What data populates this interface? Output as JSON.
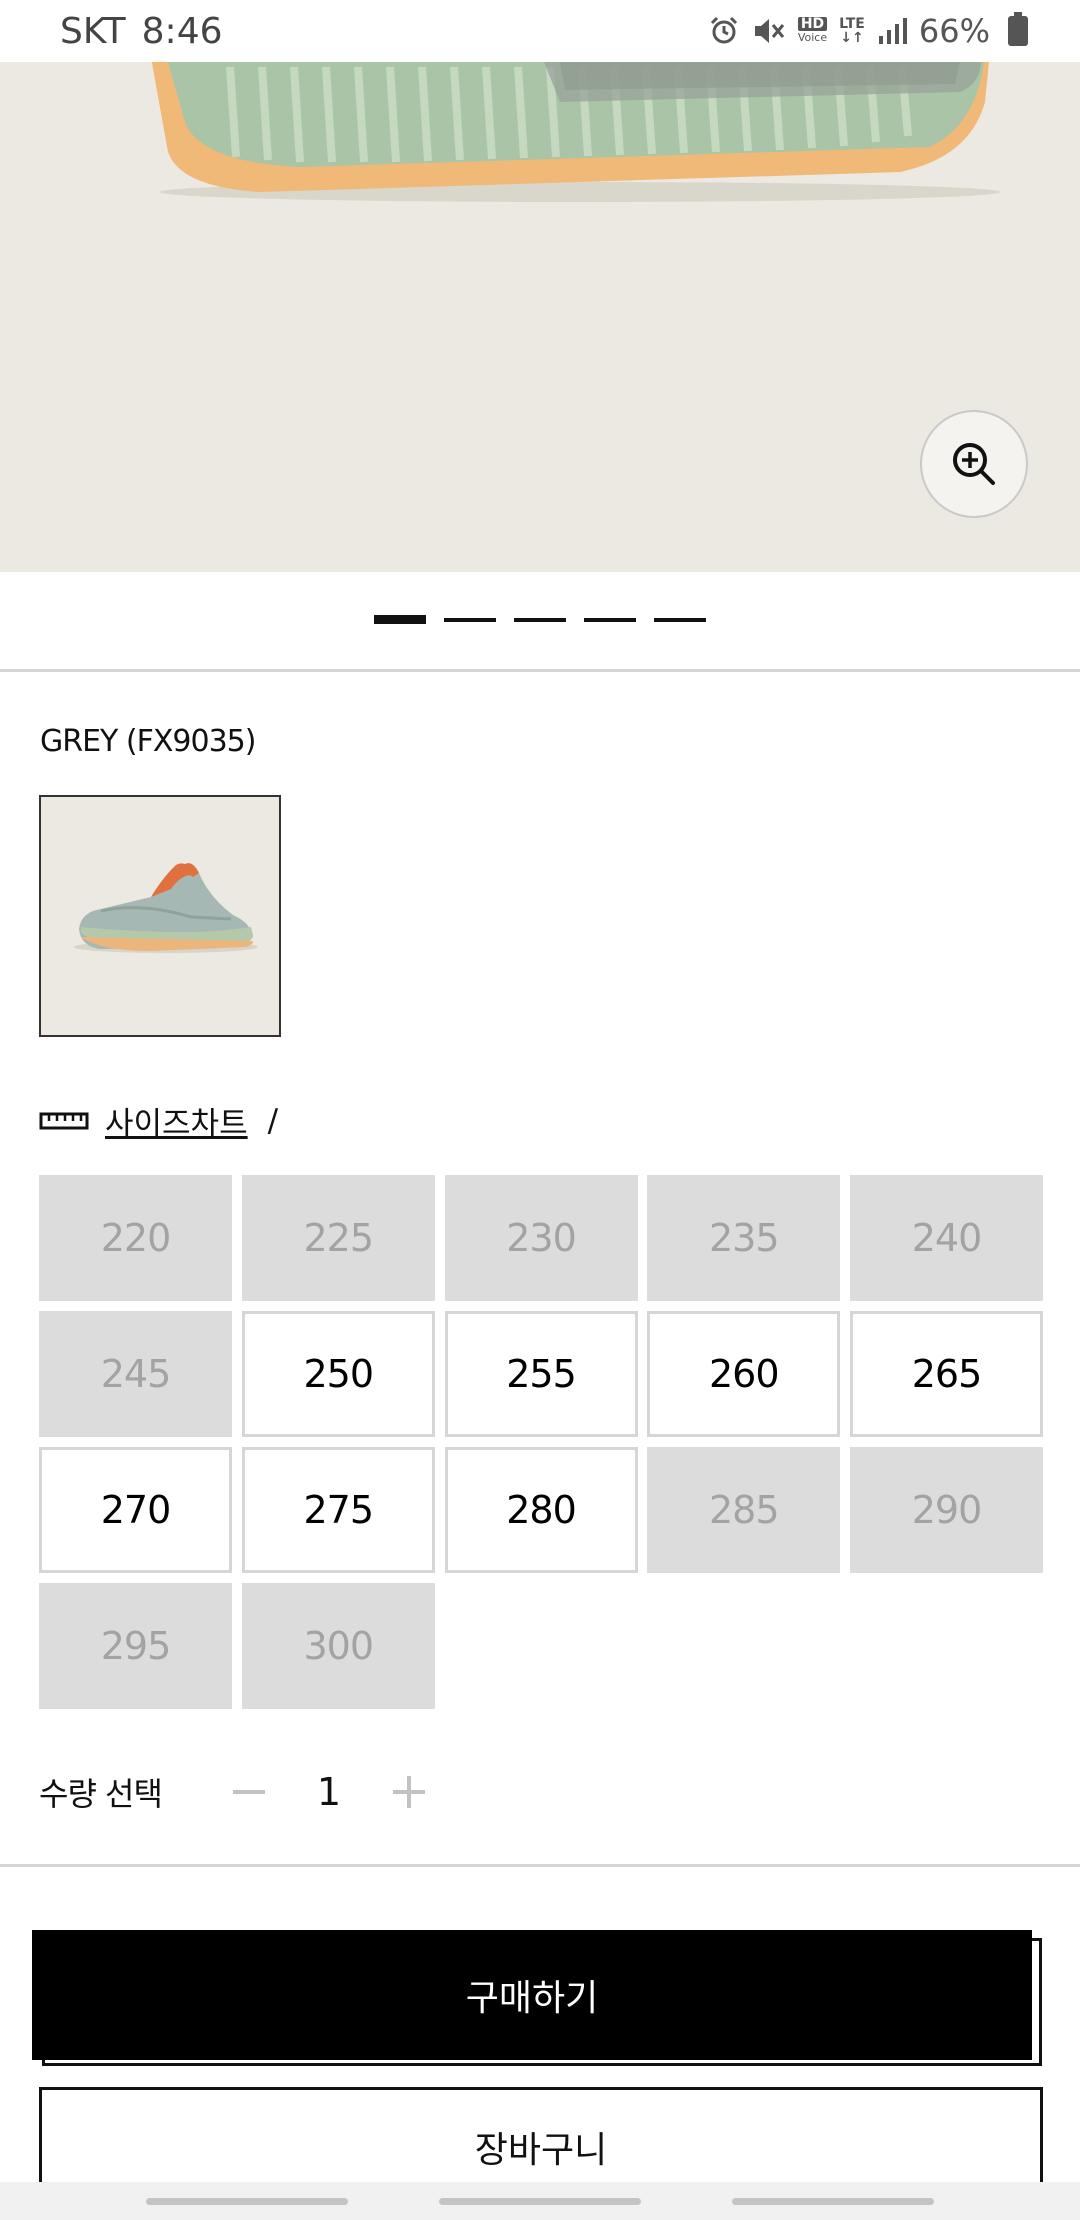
{
  "status_bar": {
    "carrier": "SKT",
    "time": "8:46",
    "hd_label": "HD",
    "voice_label": "Voice",
    "lte_label": "LTE",
    "battery": "66%"
  },
  "hero": {
    "image_icon": "sneaker-side-image",
    "zoom_icon": "zoom-in-icon",
    "slide_count": 5,
    "active_slide": 1
  },
  "product": {
    "color_label": "GREY (FX9035)"
  },
  "size_chart": {
    "icon": "ruler-icon",
    "link_label": "사이즈차트",
    "separator": "/"
  },
  "sizes": [
    {
      "label": "220",
      "available": false
    },
    {
      "label": "225",
      "available": false
    },
    {
      "label": "230",
      "available": false
    },
    {
      "label": "235",
      "available": false
    },
    {
      "label": "240",
      "available": false
    },
    {
      "label": "245",
      "available": false
    },
    {
      "label": "250",
      "available": true
    },
    {
      "label": "255",
      "available": true
    },
    {
      "label": "260",
      "available": true
    },
    {
      "label": "265",
      "available": true
    },
    {
      "label": "270",
      "available": true
    },
    {
      "label": "275",
      "available": true
    },
    {
      "label": "280",
      "available": true
    },
    {
      "label": "285",
      "available": false
    },
    {
      "label": "290",
      "available": false
    },
    {
      "label": "295",
      "available": false
    },
    {
      "label": "300",
      "available": false
    }
  ],
  "quantity": {
    "label": "수량 선택",
    "value": "1"
  },
  "actions": {
    "buy_label": "구매하기",
    "cart_label": "장바구니"
  },
  "colors": {
    "accent": "#000000",
    "soldout_bg": "#dcdcdc",
    "soldout_text": "#a3a3a3",
    "hero_bg": "#ebe9e1"
  }
}
